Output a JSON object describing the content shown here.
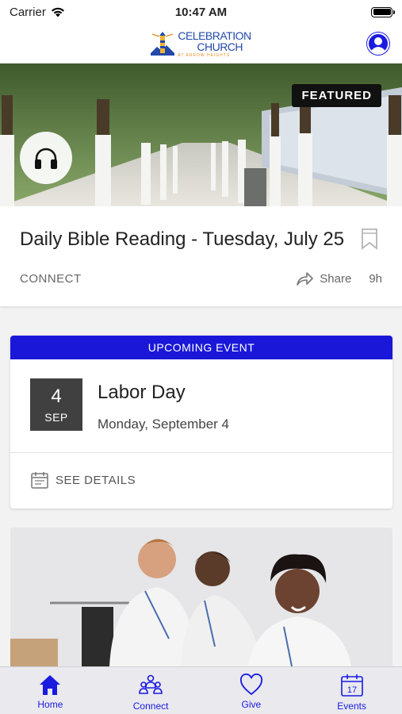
{
  "status_bar": {
    "carrier": "Carrier",
    "time": "10:47 AM"
  },
  "header": {
    "logo_line1": "CELEBRATION",
    "logo_line2": "CHURCH",
    "logo_line3": "AT ARROW HEIGHTS"
  },
  "featured": {
    "badge": "FEATURED",
    "title": "Daily Bible Reading - Tuesday, July 25",
    "category": "CONNECT",
    "share_label": "Share",
    "timestamp": "9h"
  },
  "event": {
    "header": "UPCOMING EVENT",
    "day": "4",
    "month": "SEP",
    "title": "Labor Day",
    "date": "Monday, September 4",
    "details_label": "SEE DETAILS"
  },
  "tabs": [
    {
      "label": "Home",
      "icon": "home-icon"
    },
    {
      "label": "Connect",
      "icon": "people-icon"
    },
    {
      "label": "Give",
      "icon": "heart-icon"
    },
    {
      "label": "Events",
      "icon": "calendar-icon"
    }
  ],
  "colors": {
    "accent": "#1a1ae0",
    "event_header": "#1a17d9",
    "logo_blue": "#2249a8",
    "logo_orange": "#e38b1e"
  }
}
